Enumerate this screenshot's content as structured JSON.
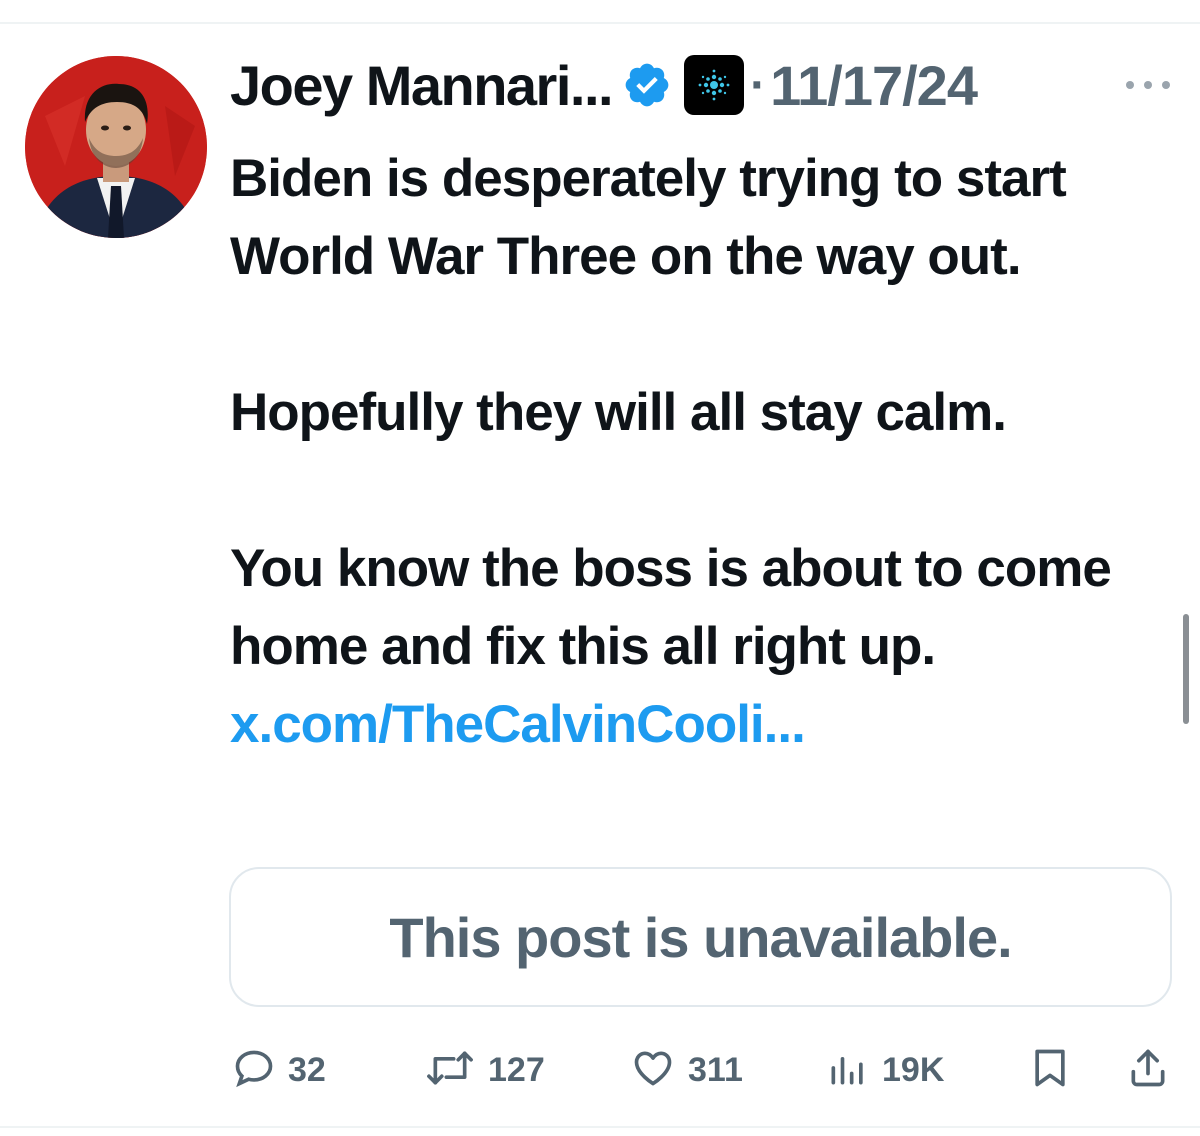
{
  "post": {
    "display_name": "Joey Mannari...",
    "separator": "·",
    "timestamp": "11/17/24",
    "body": {
      "paragraph1": "Biden is desperately trying to start World War Three on the way out.",
      "paragraph2": "Hopefully they will all stay calm.",
      "paragraph3_text": "You know the boss is about to come home and fix this all right up.",
      "paragraph3_link": "x.com/TheCalvinCooli..."
    },
    "quoted_post": {
      "message": "This post is unavailable."
    }
  },
  "actions": {
    "replies": "32",
    "reposts": "127",
    "likes": "311",
    "views": "19K"
  },
  "colors": {
    "text": "#0f1419",
    "secondary": "#536471",
    "link": "#1d9bf0",
    "verified": "#1d9bf0",
    "avatar_bg": "#c8201c"
  },
  "icons": {
    "verified": "verified-badge-icon",
    "affiliate": "affiliate-badge-icon",
    "more": "more-options-icon",
    "reply": "reply-icon",
    "repost": "repost-icon",
    "like": "heart-icon",
    "views": "views-chart-icon",
    "bookmark": "bookmark-icon",
    "share": "share-icon"
  }
}
